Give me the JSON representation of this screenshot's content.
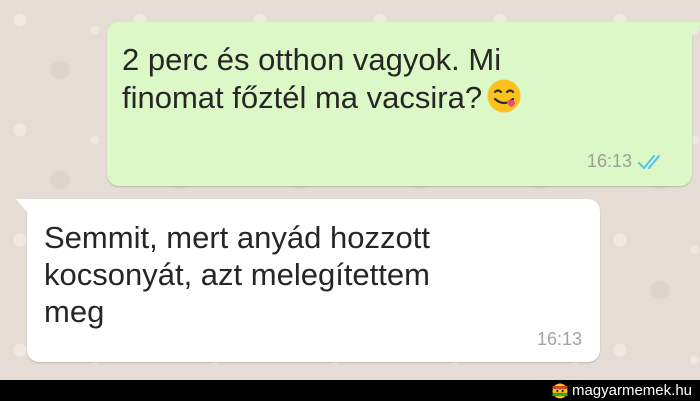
{
  "chat": {
    "messages": [
      {
        "direction": "outgoing",
        "text": "2 perc és otthon vagyok. Mi\nfinomat főztél ma vacsira?",
        "emoji": "face-savoring-food-emoji",
        "time": "16:13",
        "status": "read",
        "status_icon": "double-check-icon",
        "status_color": "#4fc3f7"
      },
      {
        "direction": "incoming",
        "text": "Semmit, mert anyád hozzott\nkocsonyát, azt melegítettem\nmeg",
        "time": "16:13"
      }
    ],
    "colors": {
      "background": "#e5ddd5",
      "outgoing_bubble": "#dcf8c6",
      "incoming_bubble": "#ffffff"
    }
  },
  "watermark": {
    "text": "magyarmemek.hu",
    "icon": "magyarmemek-logo-icon"
  }
}
